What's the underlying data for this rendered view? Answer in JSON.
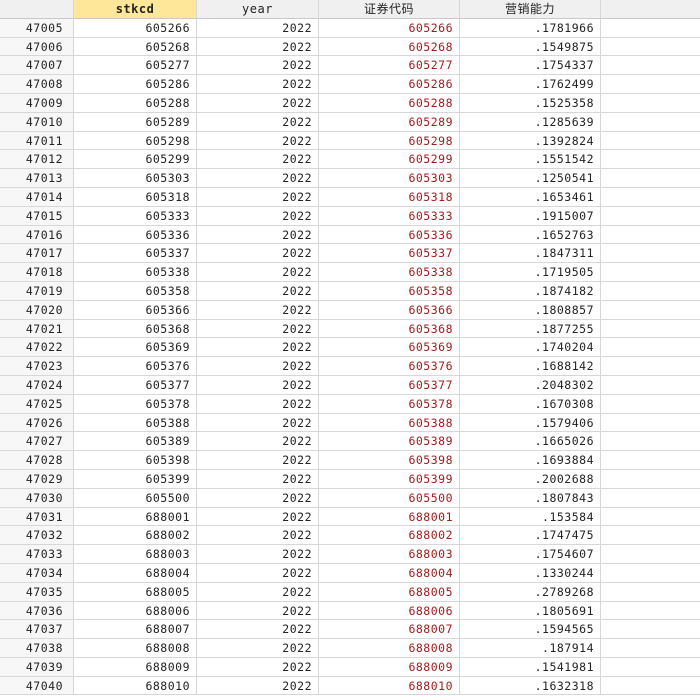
{
  "columns": {
    "stkcd": "stkcd",
    "year": "year",
    "code": "证券代码",
    "marketing": "营销能力"
  },
  "rows": [
    {
      "idx": "47005",
      "stkcd": "605266",
      "year": "2022",
      "code": "605266",
      "marketing": ".1781966"
    },
    {
      "idx": "47006",
      "stkcd": "605268",
      "year": "2022",
      "code": "605268",
      "marketing": ".1549875"
    },
    {
      "idx": "47007",
      "stkcd": "605277",
      "year": "2022",
      "code": "605277",
      "marketing": ".1754337"
    },
    {
      "idx": "47008",
      "stkcd": "605286",
      "year": "2022",
      "code": "605286",
      "marketing": ".1762499"
    },
    {
      "idx": "47009",
      "stkcd": "605288",
      "year": "2022",
      "code": "605288",
      "marketing": ".1525358"
    },
    {
      "idx": "47010",
      "stkcd": "605289",
      "year": "2022",
      "code": "605289",
      "marketing": ".1285639"
    },
    {
      "idx": "47011",
      "stkcd": "605298",
      "year": "2022",
      "code": "605298",
      "marketing": ".1392824"
    },
    {
      "idx": "47012",
      "stkcd": "605299",
      "year": "2022",
      "code": "605299",
      "marketing": ".1551542"
    },
    {
      "idx": "47013",
      "stkcd": "605303",
      "year": "2022",
      "code": "605303",
      "marketing": ".1250541"
    },
    {
      "idx": "47014",
      "stkcd": "605318",
      "year": "2022",
      "code": "605318",
      "marketing": ".1653461"
    },
    {
      "idx": "47015",
      "stkcd": "605333",
      "year": "2022",
      "code": "605333",
      "marketing": ".1915007"
    },
    {
      "idx": "47016",
      "stkcd": "605336",
      "year": "2022",
      "code": "605336",
      "marketing": ".1652763"
    },
    {
      "idx": "47017",
      "stkcd": "605337",
      "year": "2022",
      "code": "605337",
      "marketing": ".1847311"
    },
    {
      "idx": "47018",
      "stkcd": "605338",
      "year": "2022",
      "code": "605338",
      "marketing": ".1719505"
    },
    {
      "idx": "47019",
      "stkcd": "605358",
      "year": "2022",
      "code": "605358",
      "marketing": ".1874182"
    },
    {
      "idx": "47020",
      "stkcd": "605366",
      "year": "2022",
      "code": "605366",
      "marketing": ".1808857"
    },
    {
      "idx": "47021",
      "stkcd": "605368",
      "year": "2022",
      "code": "605368",
      "marketing": ".1877255"
    },
    {
      "idx": "47022",
      "stkcd": "605369",
      "year": "2022",
      "code": "605369",
      "marketing": ".1740204"
    },
    {
      "idx": "47023",
      "stkcd": "605376",
      "year": "2022",
      "code": "605376",
      "marketing": ".1688142"
    },
    {
      "idx": "47024",
      "stkcd": "605377",
      "year": "2022",
      "code": "605377",
      "marketing": ".2048302"
    },
    {
      "idx": "47025",
      "stkcd": "605378",
      "year": "2022",
      "code": "605378",
      "marketing": ".1670308"
    },
    {
      "idx": "47026",
      "stkcd": "605388",
      "year": "2022",
      "code": "605388",
      "marketing": ".1579406"
    },
    {
      "idx": "47027",
      "stkcd": "605389",
      "year": "2022",
      "code": "605389",
      "marketing": ".1665026"
    },
    {
      "idx": "47028",
      "stkcd": "605398",
      "year": "2022",
      "code": "605398",
      "marketing": ".1693884"
    },
    {
      "idx": "47029",
      "stkcd": "605399",
      "year": "2022",
      "code": "605399",
      "marketing": ".2002688"
    },
    {
      "idx": "47030",
      "stkcd": "605500",
      "year": "2022",
      "code": "605500",
      "marketing": ".1807843"
    },
    {
      "idx": "47031",
      "stkcd": "688001",
      "year": "2022",
      "code": "688001",
      "marketing": ".153584"
    },
    {
      "idx": "47032",
      "stkcd": "688002",
      "year": "2022",
      "code": "688002",
      "marketing": ".1747475"
    },
    {
      "idx": "47033",
      "stkcd": "688003",
      "year": "2022",
      "code": "688003",
      "marketing": ".1754607"
    },
    {
      "idx": "47034",
      "stkcd": "688004",
      "year": "2022",
      "code": "688004",
      "marketing": ".1330244"
    },
    {
      "idx": "47035",
      "stkcd": "688005",
      "year": "2022",
      "code": "688005",
      "marketing": ".2789268"
    },
    {
      "idx": "47036",
      "stkcd": "688006",
      "year": "2022",
      "code": "688006",
      "marketing": ".1805691"
    },
    {
      "idx": "47037",
      "stkcd": "688007",
      "year": "2022",
      "code": "688007",
      "marketing": ".1594565"
    },
    {
      "idx": "47038",
      "stkcd": "688008",
      "year": "2022",
      "code": "688008",
      "marketing": ".187914"
    },
    {
      "idx": "47039",
      "stkcd": "688009",
      "year": "2022",
      "code": "688009",
      "marketing": ".1541981"
    },
    {
      "idx": "47040",
      "stkcd": "688010",
      "year": "2022",
      "code": "688010",
      "marketing": ".1632318"
    }
  ]
}
